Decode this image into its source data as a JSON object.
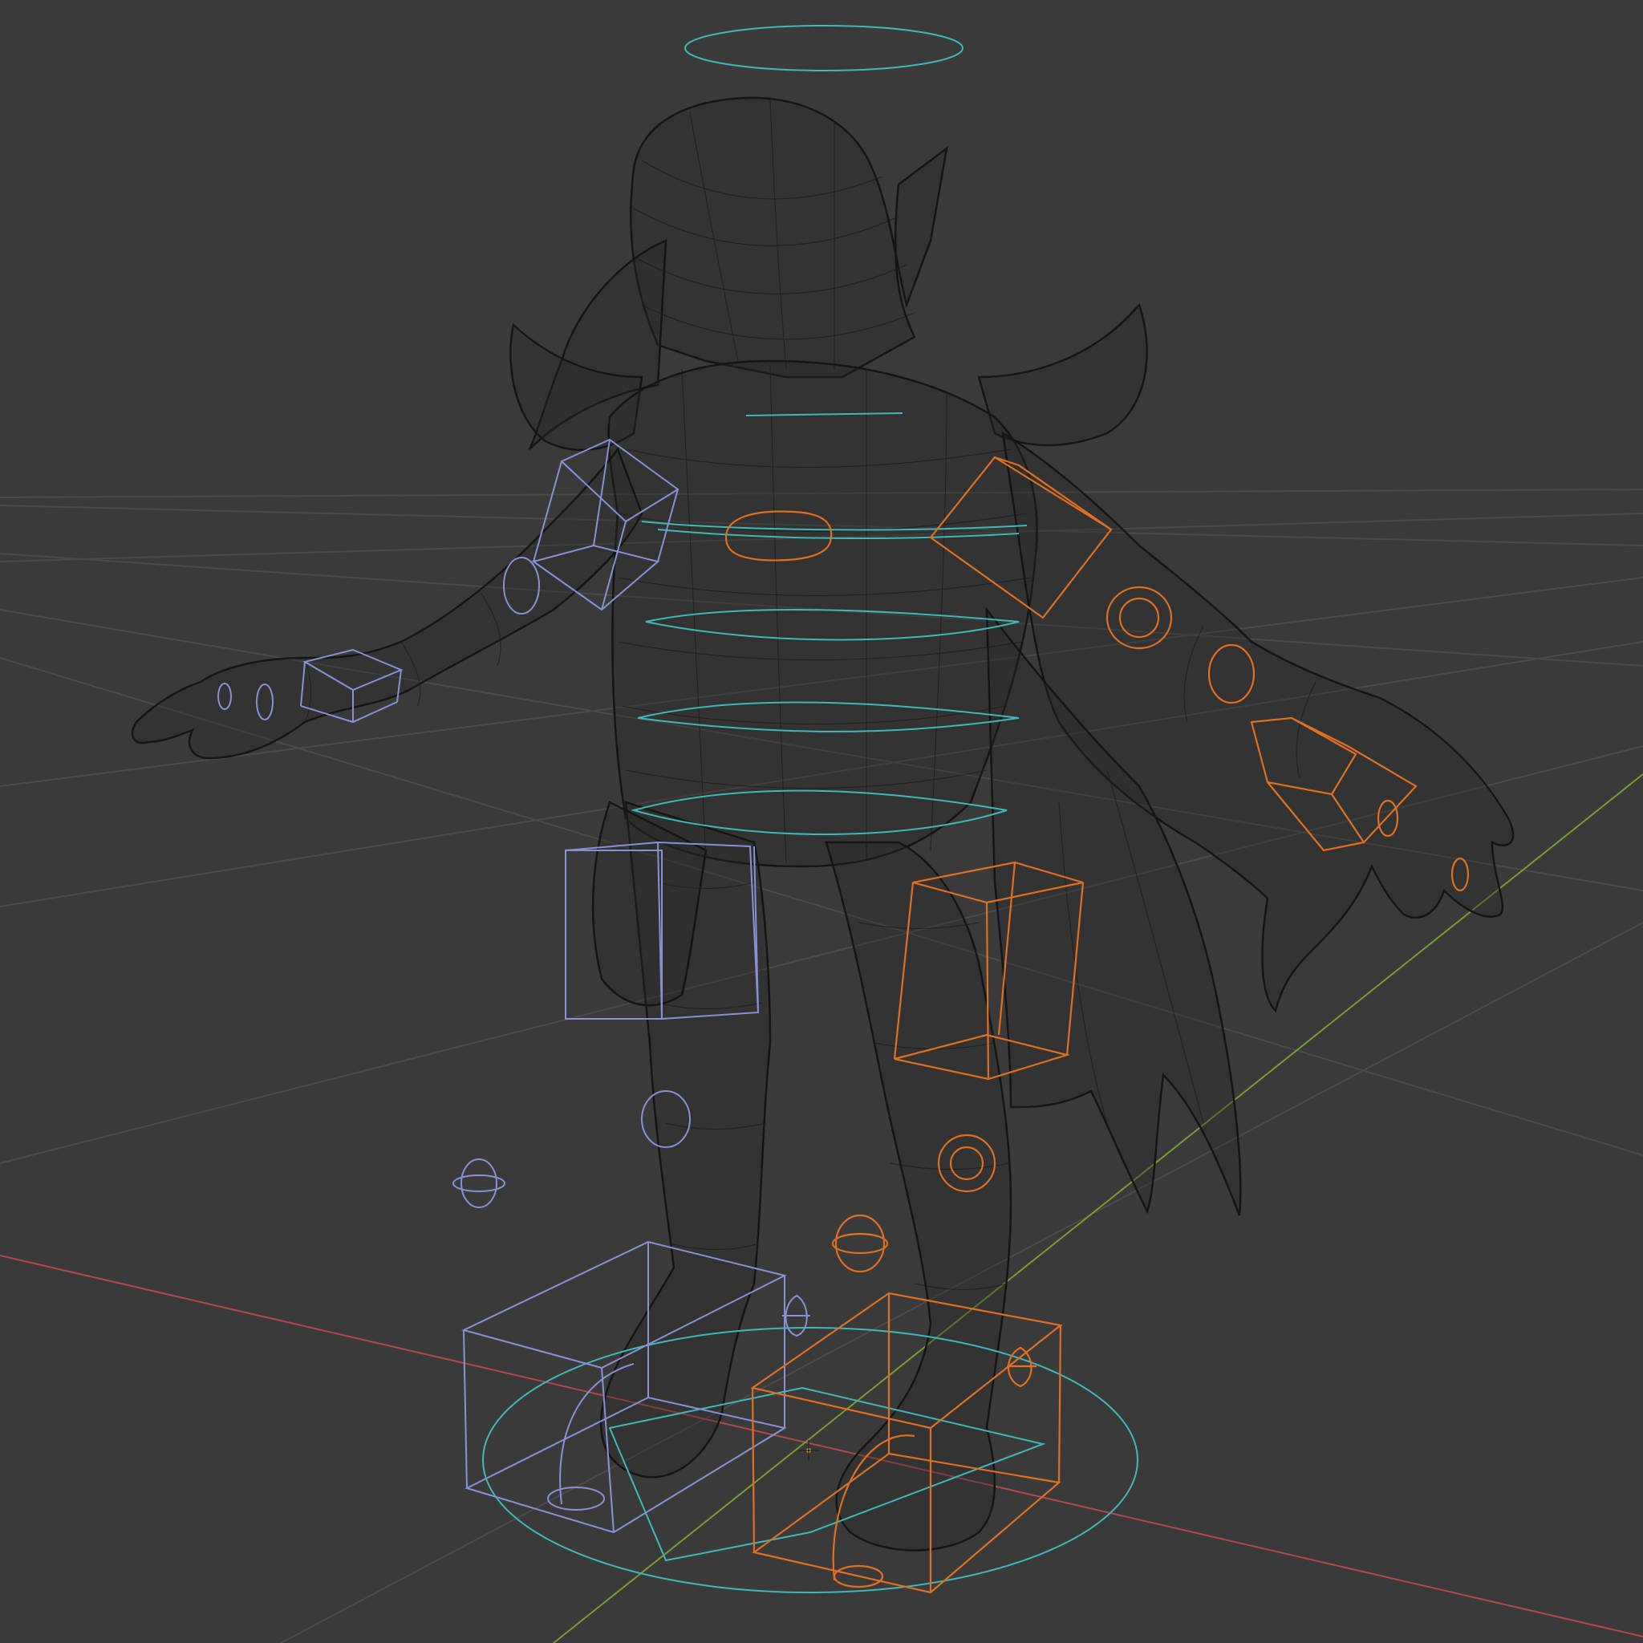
{
  "viewport": {
    "mode": "wireframe",
    "background": "#3a3a3a",
    "grid_color": "#4a4a4a",
    "x_axis_color": "#b5484f",
    "y_axis_color": "#7c9a2e"
  },
  "colors": {
    "mesh_wire": "#111111",
    "control_root": "#3fb8b8",
    "control_left": "#8a90d8",
    "control_right": "#e06f22",
    "origin_marker": "#e8a33c"
  },
  "scene": {
    "object": "wireframe-character-mesh",
    "rig_controls": [
      "head-halo-control",
      "chest-ring-control",
      "spine-ring-controls",
      "hip-ring-control",
      "root-circle-control",
      "left-arm-ik-controls",
      "right-arm-ik-controls",
      "left-foot-box-control",
      "right-foot-box-control",
      "knee-pole-targets"
    ]
  }
}
